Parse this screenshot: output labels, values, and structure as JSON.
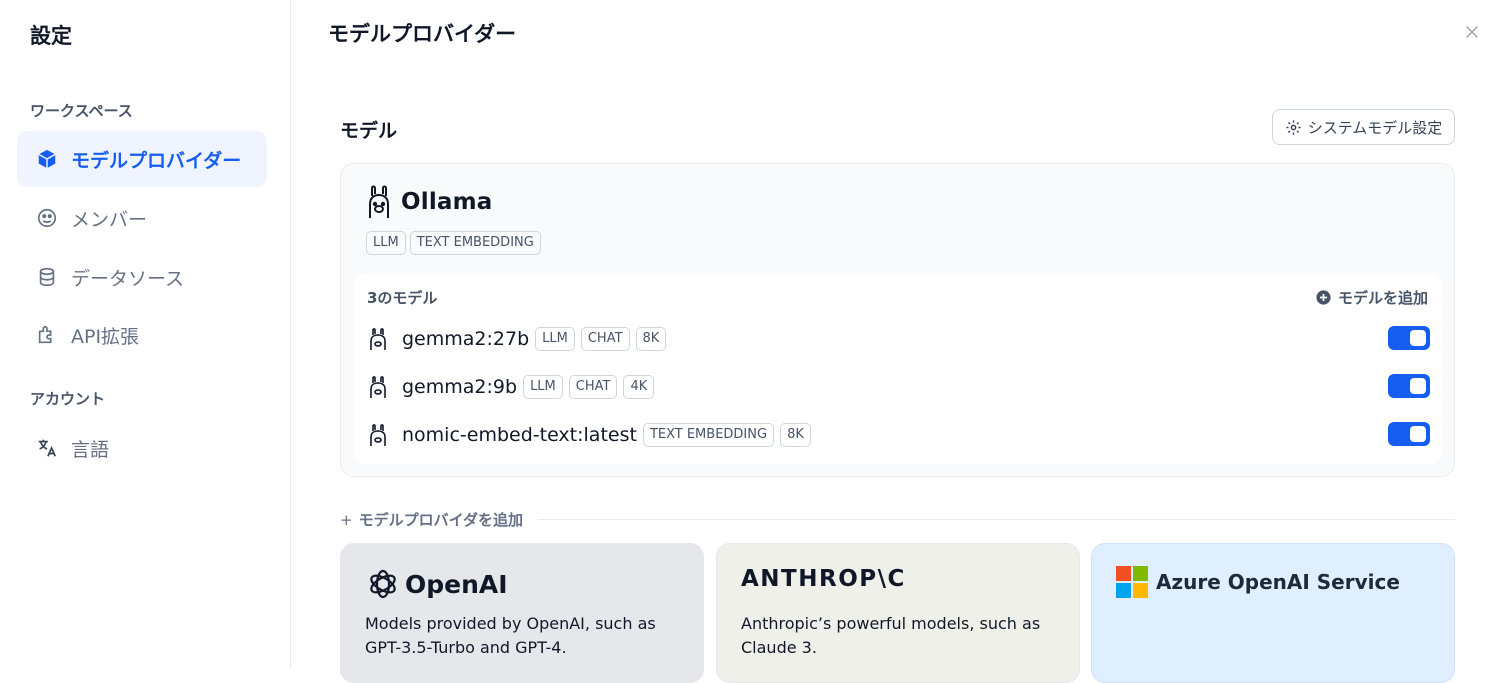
{
  "sidebar": {
    "title": "設定",
    "sections": {
      "workspace": "ワークスペース",
      "account": "アカウント"
    },
    "items": [
      {
        "label": "モデルプロバイダー",
        "icon": "cube-icon"
      },
      {
        "label": "メンバー",
        "icon": "members-icon"
      },
      {
        "label": "データソース",
        "icon": "database-icon"
      },
      {
        "label": "API拡張",
        "icon": "puzzle-icon"
      },
      {
        "label": "言語",
        "icon": "translate-icon"
      }
    ]
  },
  "header": {
    "title": "モデルプロバイダー",
    "close_icon": "close-icon"
  },
  "models_section": {
    "label": "モデル",
    "system_button": "システムモデル設定"
  },
  "provider": {
    "name": "Ollama",
    "tags": [
      "LLM",
      "TEXT EMBEDDING"
    ],
    "model_count": "3のモデル",
    "add_model": "モデルを追加",
    "models": [
      {
        "name": "gemma2:27b",
        "tags": [
          "LLM",
          "CHAT",
          "8K"
        ],
        "enabled": true
      },
      {
        "name": "gemma2:9b",
        "tags": [
          "LLM",
          "CHAT",
          "4K"
        ],
        "enabled": true
      },
      {
        "name": "nomic-embed-text:latest",
        "tags": [
          "TEXT EMBEDDING",
          "8K"
        ],
        "enabled": true
      }
    ]
  },
  "add_provider": {
    "plus": "+",
    "label": "モデルプロバイダを追加"
  },
  "provider_cards": [
    {
      "name": "OpenAI",
      "description": "Models provided by OpenAI, such as GPT-3.5-Turbo and GPT-4."
    },
    {
      "name": "ANTHROP\\C",
      "description": "Anthropic’s powerful models, such as Claude 3."
    },
    {
      "name": "Azure OpenAI Service",
      "description": ""
    }
  ],
  "colors": {
    "accent": "#155eef",
    "active_bg": "#eff4ff"
  }
}
